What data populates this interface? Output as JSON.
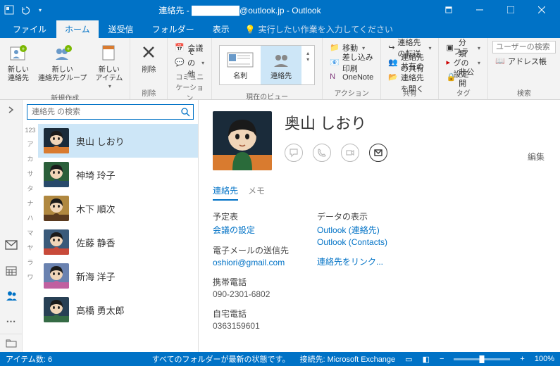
{
  "titlebar": {
    "title": "連絡先 - ████████@outlook.jp - Outlook"
  },
  "tabs": {
    "file": "ファイル",
    "home": "ホーム",
    "send_receive": "送受信",
    "folder": "フォルダー",
    "view": "表示",
    "tell_me": "実行したい作業を入力してください"
  },
  "ribbon": {
    "new_group": {
      "label": "新規作成",
      "new_contact": "新しい\n連絡先",
      "new_group_btn": "新しい\n連絡先グループ",
      "new_item": "新しい\nアイテム"
    },
    "delete_group": {
      "label": "削除",
      "delete": "削除"
    },
    "comm_group": {
      "label": "コミュニケーション",
      "meeting": "会議",
      "other": "その他"
    },
    "view_group": {
      "label": "現在のビュー",
      "card": "名刺",
      "contacts": "連絡先"
    },
    "action_group": {
      "label": "アクション",
      "move": "移動",
      "mailmerge": "差し込み印刷",
      "onenote": "OneNote"
    },
    "share_group": {
      "label": "共有",
      "forward": "連絡先の転送",
      "share": "連絡先の共有",
      "open_shared": "共有の連絡先を開く"
    },
    "tag_group": {
      "label": "タグ",
      "categorize": "分類",
      "flag": "フラグの設定",
      "private": "非公開"
    },
    "find_group": {
      "label": "検索",
      "search_ph": "ユーザーの検索",
      "addressbook": "アドレス帳"
    }
  },
  "search": {
    "placeholder": "連絡先 の検索"
  },
  "index": [
    "123",
    "ア",
    "カ",
    "サ",
    "タ",
    "ナ",
    "ハ",
    "マ",
    "ヤ",
    "ラ",
    "ワ"
  ],
  "contacts": [
    {
      "name": "奥山 しおり",
      "selected": true,
      "colors": [
        "#1a2b3a",
        "#d97b2f"
      ]
    },
    {
      "name": "神埼 玲子",
      "selected": false,
      "colors": [
        "#2b5f3a",
        "#284a6b"
      ]
    },
    {
      "name": "木下 順次",
      "selected": false,
      "colors": [
        "#b08840",
        "#5a3a1f"
      ]
    },
    {
      "name": "佐藤 静香",
      "selected": false,
      "colors": [
        "#3a5a7a",
        "#c84a3a"
      ]
    },
    {
      "name": "新海 洋子",
      "selected": false,
      "colors": [
        "#6a82b0",
        "#c060a0"
      ]
    },
    {
      "name": "高橋 勇太郎",
      "selected": false,
      "colors": [
        "#284055",
        "#356b45"
      ]
    }
  ],
  "card": {
    "name": "奥山 しおり",
    "edit": "編集",
    "tabs": {
      "contact": "連絡先",
      "memo": "メモ"
    },
    "left": {
      "calendar_label": "予定表",
      "calendar_link": "会議の設定",
      "email_label": "電子メールの送信先",
      "email_value": "oshiori@gmail.com",
      "mobile_label": "携帯電話",
      "mobile_value": "090-2301-6802",
      "home_label": "自宅電話",
      "home_value": "0363159601"
    },
    "right": {
      "view_label": "データの表示",
      "link1": "Outlook (連絡先)",
      "link2": "Outlook (Contacts)",
      "link_contacts": "連絡先をリンク..."
    }
  },
  "statusbar": {
    "items": "アイテム数: 6",
    "folder_status": "すべてのフォルダーが最新の状態です。",
    "connection": "接続先: Microsoft Exchange",
    "zoom": "100%"
  }
}
